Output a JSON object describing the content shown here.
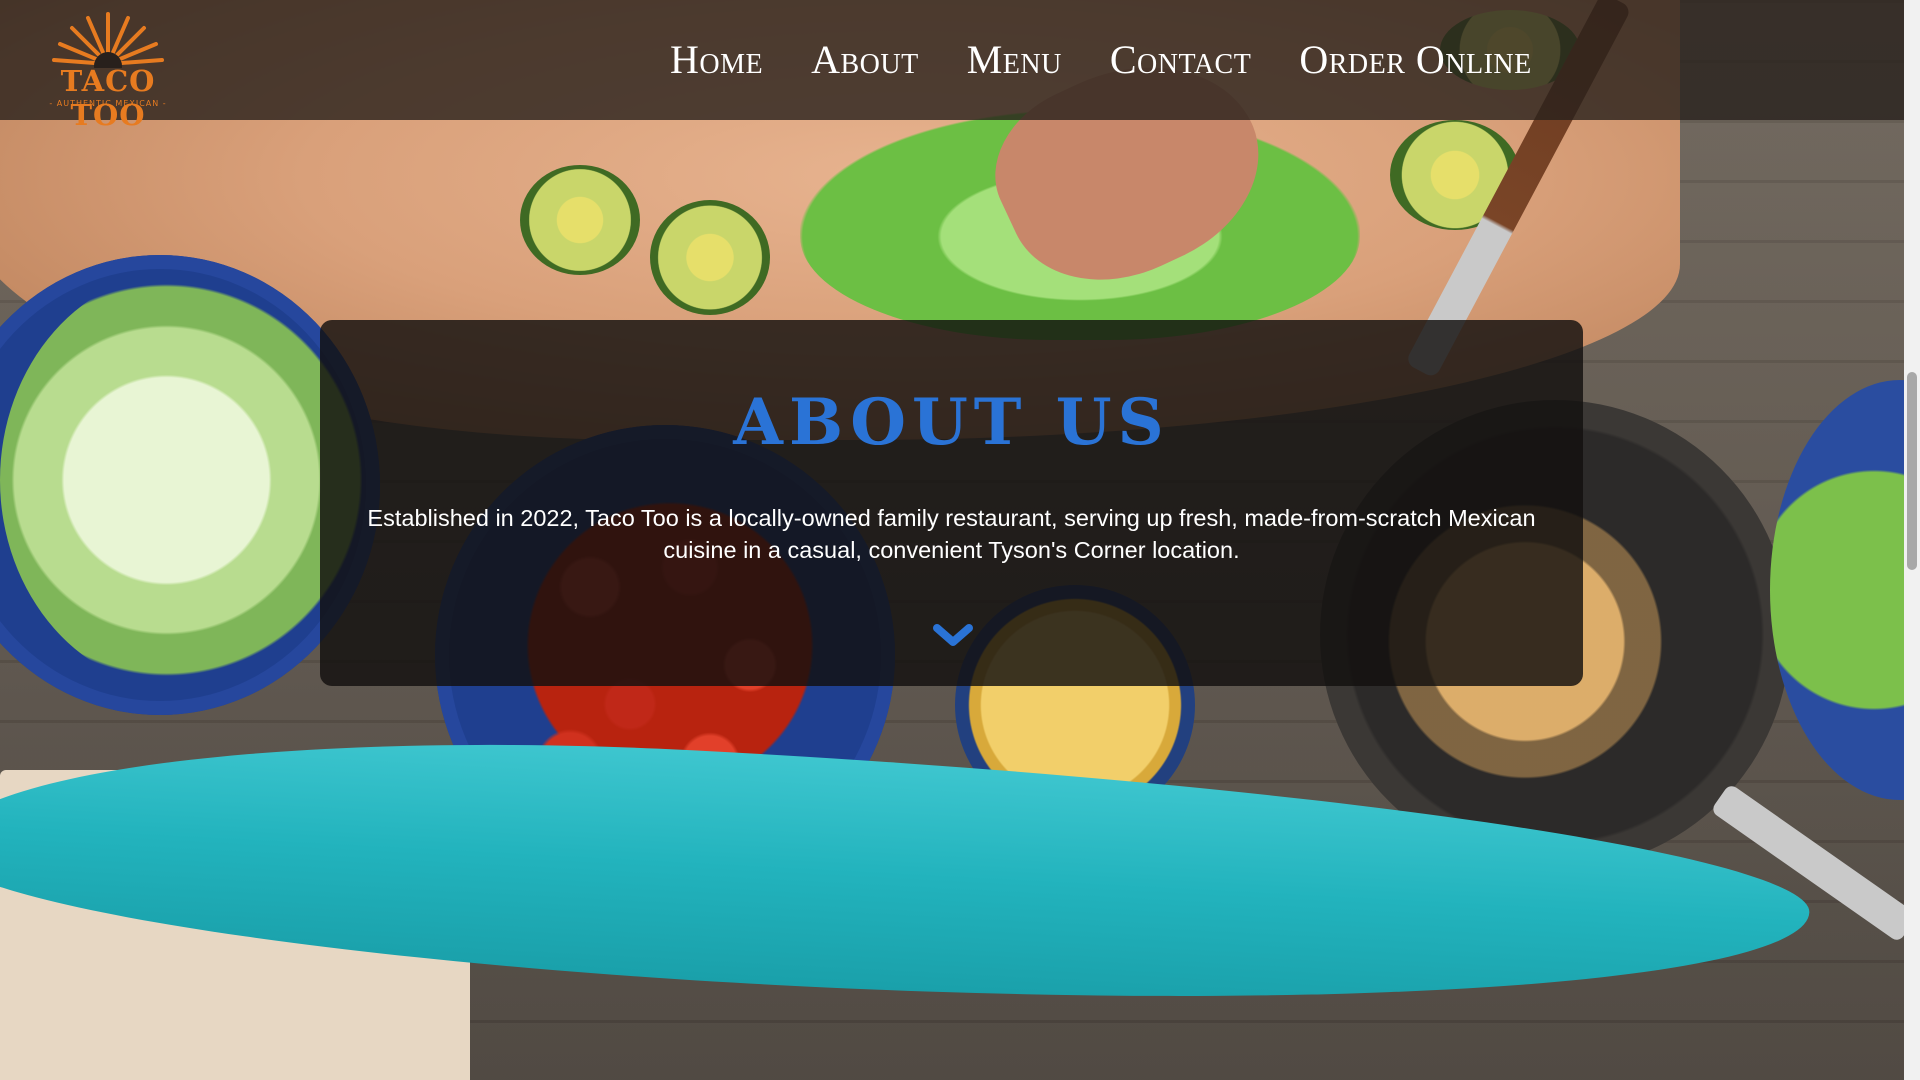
{
  "brand": {
    "name": "TACO TOO",
    "tagline": "- AUTHENTIC MEXICAN -",
    "color": "#e77b20"
  },
  "nav": {
    "items": [
      {
        "label": "Home"
      },
      {
        "label": "About"
      },
      {
        "label": "Menu"
      },
      {
        "label": "Contact"
      },
      {
        "label": "Order Online"
      }
    ]
  },
  "about": {
    "title": "ABOUT US",
    "title_color": "#2a73d6",
    "text": "Established in 2022, Taco Too is a locally-owned family restaurant, serving up fresh, made-from-scratch Mexican cuisine in a casual, convenient Tyson's Corner location.",
    "scroll_icon": "chevron-down-icon"
  },
  "background": {
    "description_icon": "food-prep-table-photo"
  }
}
